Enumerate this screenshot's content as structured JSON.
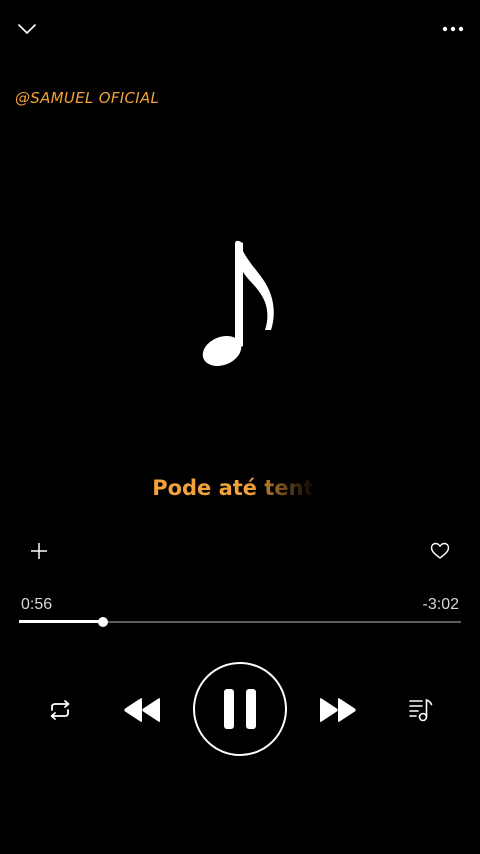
{
  "header": {
    "collapse_icon": "chevron-down-icon",
    "more_icon": "more-horizontal-icon"
  },
  "watermark": {
    "text": "@SAMUEL OFICIAL",
    "color": "#f3a23a"
  },
  "artwork": {
    "icon": "music-note-icon"
  },
  "lyrics": {
    "current_line": "Pode até tenta",
    "color": "#f3a23a"
  },
  "actions": {
    "add_icon": "plus-icon",
    "favorite_icon": "heart-outline-icon"
  },
  "playback": {
    "elapsed": "0:56",
    "remaining": "-3:02",
    "progress": 0.19
  },
  "controls": {
    "repeat_icon": "repeat-icon",
    "previous_icon": "rewind-icon",
    "play_pause_icon": "pause-icon",
    "next_icon": "fast-forward-icon",
    "queue_icon": "playlist-icon"
  }
}
